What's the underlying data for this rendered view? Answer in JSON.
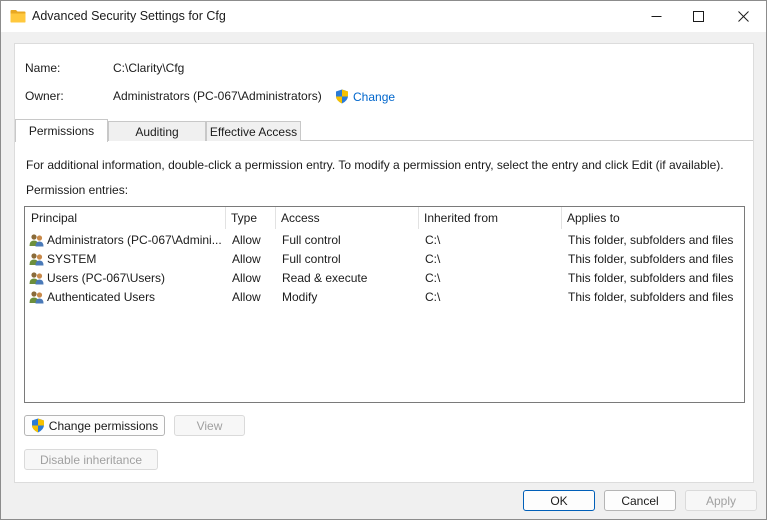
{
  "window": {
    "title": "Advanced Security Settings for Cfg",
    "icon": "folder-icon"
  },
  "details": {
    "name_label": "Name:",
    "name_value": "C:\\Clarity\\Cfg",
    "owner_label": "Owner:",
    "owner_value": "Administrators (PC-067\\Administrators)",
    "change_label": "Change"
  },
  "tabs": [
    {
      "label": "Permissions",
      "active": true
    },
    {
      "label": "Auditing",
      "active": false
    },
    {
      "label": "Effective Access",
      "active": false
    }
  ],
  "info_text": "For additional information, double-click a permission entry. To modify a permission entry, select the entry and click Edit (if available).",
  "entries_label": "Permission entries:",
  "table": {
    "columns": [
      "Principal",
      "Type",
      "Access",
      "Inherited from",
      "Applies to"
    ],
    "rows": [
      {
        "principal": "Administrators (PC-067\\Admini...",
        "type": "Allow",
        "access": "Full control",
        "inherited": "C:\\",
        "applies": "This folder, subfolders and files"
      },
      {
        "principal": "SYSTEM",
        "type": "Allow",
        "access": "Full control",
        "inherited": "C:\\",
        "applies": "This folder, subfolders and files"
      },
      {
        "principal": "Users (PC-067\\Users)",
        "type": "Allow",
        "access": "Read & execute",
        "inherited": "C:\\",
        "applies": "This folder, subfolders and files"
      },
      {
        "principal": "Authenticated Users",
        "type": "Allow",
        "access": "Modify",
        "inherited": "C:\\",
        "applies": "This folder, subfolders and files"
      }
    ]
  },
  "buttons": {
    "change_permissions": "Change permissions",
    "view": "View",
    "disable_inheritance": "Disable inheritance",
    "ok": "OK",
    "cancel": "Cancel",
    "apply": "Apply"
  },
  "colors": {
    "link": "#0066cc",
    "accent": "#005fb8"
  }
}
